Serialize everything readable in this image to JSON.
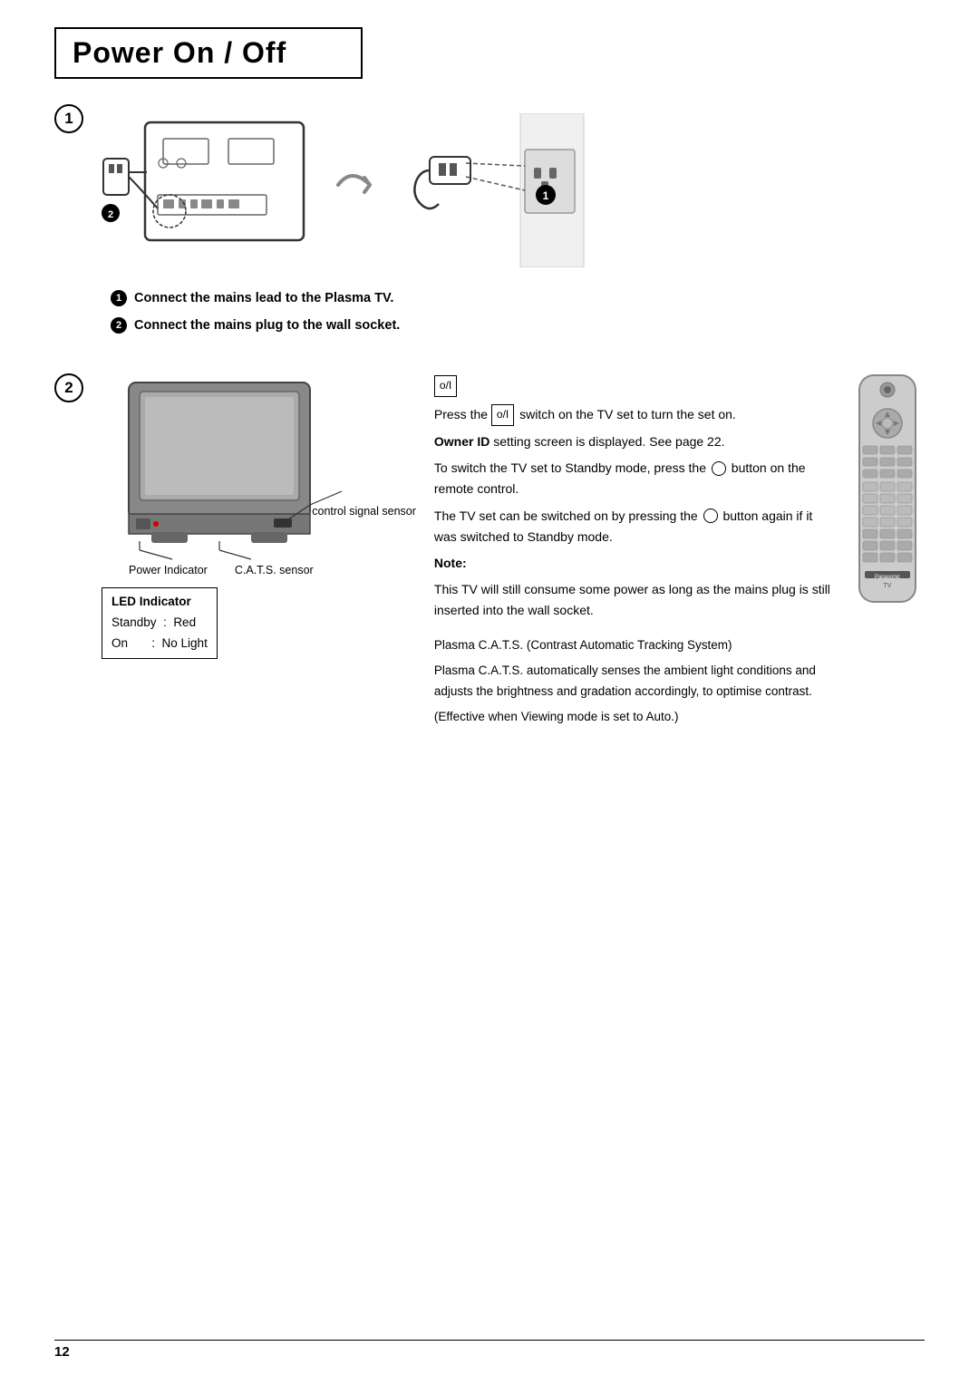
{
  "page": {
    "title": "Power On / Off",
    "page_number": "12"
  },
  "section1": {
    "number": "1",
    "step1_label": "Connect the mains lead to the Plasma TV.",
    "step2_label": "Connect the mains plug to the wall socket."
  },
  "section2": {
    "number": "2",
    "switch_symbol": "o/I",
    "press_instruction": "Press the  switch on the TV set to turn the set on.",
    "owner_id_text": "Owner ID setting screen is displayed. See page 22.",
    "standby_instruction": "To switch the TV set to Standby mode, press the  button on the remote control.",
    "switch_on_instruction": "The TV set can be switched on by pressing the  button again if it was switched to Standby mode.",
    "note_label": "Note:",
    "note_text": "This TV will still consume some power as long as the mains plug is still inserted into the wall socket.",
    "power_indicator_label": "Power Indicator",
    "remote_signal_label": "Remote control signal sensor",
    "cats_label": "C.A.T.S. sensor",
    "cats_full": "Plasma C.A.T.S. (Contrast Automatic Tracking System)",
    "cats_desc1": "Plasma C.A.T.S. automatically senses the ambient light conditions and adjusts the brightness and gradation accordingly, to optimise contrast.",
    "cats_desc2": "(Effective when Viewing mode is set to Auto.)"
  },
  "led_indicator": {
    "title": "LED Indicator",
    "standby_label": "Standby",
    "standby_value": "Red",
    "on_label": "On",
    "on_value": "No Light"
  }
}
